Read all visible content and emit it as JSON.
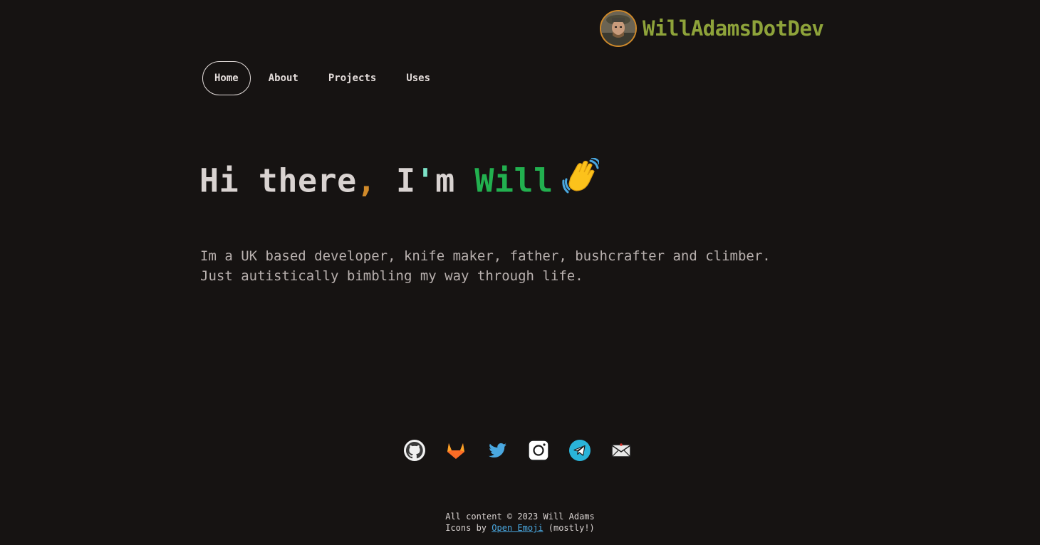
{
  "header": {
    "brand_name": "WillAdamsDotDev",
    "avatar_icon": "avatar-photo"
  },
  "nav": {
    "items": [
      {
        "label": "Home",
        "active": true
      },
      {
        "label": "About",
        "active": false
      },
      {
        "label": "Projects",
        "active": false
      },
      {
        "label": "Uses",
        "active": false
      }
    ]
  },
  "hero": {
    "greeting_hi": "Hi there",
    "greeting_comma": ",",
    "greeting_i": "I",
    "greeting_apos": "'",
    "greeting_m": "m",
    "name": "Will",
    "wave_icon": "waving-hand-icon"
  },
  "intro": {
    "line1": "Im a UK based developer, knife maker, father, bushcrafter and climber.",
    "line2": "Just autistically bimbling my way through life."
  },
  "socials": [
    {
      "name": "github-icon"
    },
    {
      "name": "gitlab-icon"
    },
    {
      "name": "twitter-icon"
    },
    {
      "name": "instagram-icon"
    },
    {
      "name": "telegram-icon"
    },
    {
      "name": "email-icon"
    }
  ],
  "footer": {
    "copyright": "All content © 2023 Will Adams",
    "icons_prefix": "Icons by ",
    "icons_link": "Open Emoji",
    "icons_suffix": " (mostly!)"
  },
  "colors": {
    "background": "#161312",
    "brand": "#8ea33a",
    "accent_orange": "#d08a2a",
    "name_green": "#22b04f",
    "link_blue": "#4aa8e0"
  }
}
